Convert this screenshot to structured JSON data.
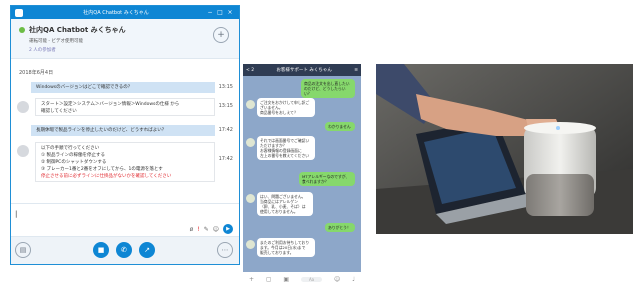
{
  "skype": {
    "window_title": "社内QA Chatbot みくちゃん",
    "window_controls": [
      "−",
      "□",
      "×"
    ],
    "bot_name": "社内QA Chatbot みくちゃん",
    "bot_status": "運転可能 - ビデオ使用可能",
    "participants": "2 人の参加者",
    "add_button": "+",
    "date": "2018年6月4日",
    "messages": [
      {
        "side": "out",
        "text": "Windowsのバージョンはどこで確認できるの？",
        "time": "13:15"
      },
      {
        "side": "in",
        "lines": [
          "スタート＞設定＞システム＞バージョン情報＞Windowsの仕様 から",
          "確認してください"
        ],
        "time": "13:15"
      },
      {
        "side": "out",
        "text": "長期休暇で製品ラインを停止したいのだけど、どうすればよい？",
        "time": "17:42"
      },
      {
        "side": "in",
        "lines": [
          "以下の手順で行ってください",
          "① 製品ラインの稼働を停止する",
          "② 制御PCのシャットダウンする",
          "③ ブレーカー1番と2番をオフにしてから、1の電源を落とす"
        ],
        "red_lines": [
          "停止させる前に必ずラインに仕掛品がないかを確認してください"
        ],
        "time": "17:42"
      }
    ],
    "compose_caret": "|",
    "compose_tools": [
      "ø",
      "!",
      "✎",
      "☺"
    ],
    "send_icon": "▶",
    "bottom_buttons": [
      "▤",
      "■",
      "✆",
      "↗",
      "⋯"
    ]
  },
  "line": {
    "back": "< 2",
    "title": "お客様サポート みくちゃん",
    "menu": "≡",
    "messages": [
      {
        "side": "me",
        "lines": [
          "商品の注文を出し直したいのだけど、どうしたらいい？"
        ]
      },
      {
        "side": "bot",
        "lines": [
          "ご注文をおかけして申し訳ございません。",
          "商品番号をおしえて？"
        ]
      },
      {
        "side": "me",
        "lines": [
          "わかりません"
        ]
      },
      {
        "side": "bot",
        "lines": [
          "それでは画面番号でご確認いただけますか？",
          "お客様情報の登録画面に",
          "左上の番号を教えてください"
        ]
      },
      {
        "side": "me",
        "lines": [
          "MTアレルギーなのですが、",
          "食べれますか？"
        ]
      },
      {
        "side": "bot",
        "lines": [
          "はい、問題ございません。",
          "当商品にはアレルゲン",
          "（卵、乳、小麦、そば）は",
          "使用しておりません。"
        ]
      },
      {
        "side": "me",
        "lines": [
          "ありがとう！"
        ]
      },
      {
        "side": "bot",
        "lines": [
          "またのご利用お待ちしております。今月は20日(水)まで",
          "販売しております。"
        ]
      }
    ],
    "footer_icons": [
      "+",
      "▢",
      "▣",
      "☺",
      "♩"
    ],
    "footer_input": "Aa"
  },
  "photo": {
    "description_icon": "smart-speaker-photo"
  },
  "colors": {
    "skype_blue": "#0e86d4",
    "line_bg": "#8da7c9",
    "line_green": "#86d86c",
    "warning_red": "#e0282e"
  }
}
